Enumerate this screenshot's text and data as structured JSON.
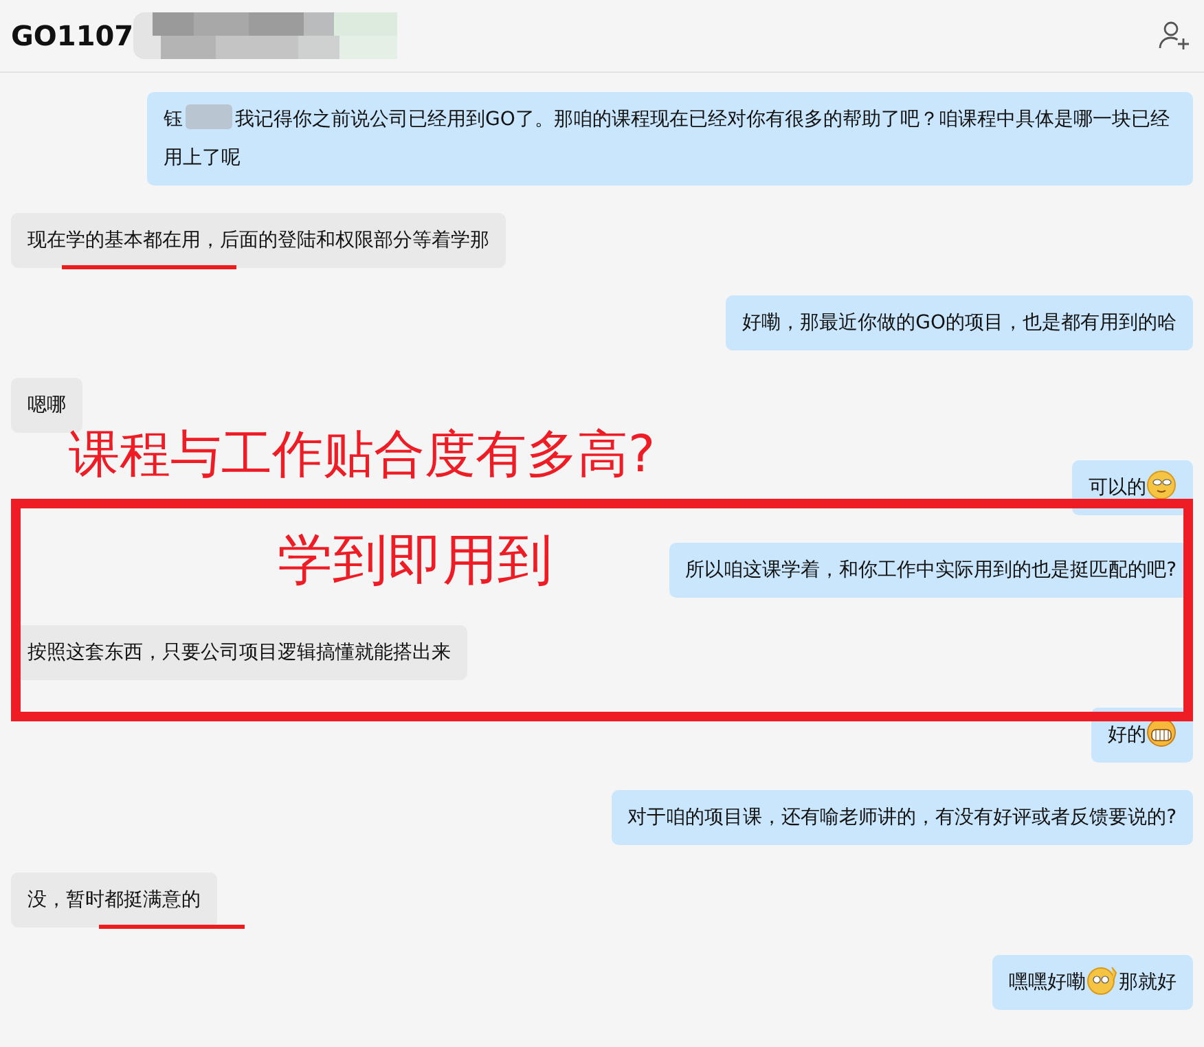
{
  "chat": {
    "title": "GO1107",
    "title_redacted": true
  },
  "messages": [
    {
      "outgoing": true,
      "parts": [
        {
          "kind": "text",
          "prefix": "钰",
          "redacted": true,
          "text": "我记得你之前说公司已经用到GO了。那咱的课程现在已经对你有很多的帮助了吧？咱课程中具体是哪一块已经用上了呢"
        }
      ]
    },
    {
      "outgoing": false,
      "parts": [
        {
          "kind": "text",
          "text": "现在学的基本都在用，后面的登陆和权限部分等着学那"
        }
      ]
    },
    {
      "outgoing": true,
      "parts": [
        {
          "kind": "text",
          "text": "好嘞，那最近你做的GO的项目，也是都有用到的哈"
        }
      ]
    },
    {
      "outgoing": false,
      "parts": [
        {
          "kind": "text",
          "text": "嗯哪"
        }
      ]
    },
    {
      "outgoing": true,
      "parts": [
        {
          "kind": "text",
          "text": "可以的"
        },
        {
          "kind": "emoji_smirk"
        }
      ]
    },
    {
      "outgoing": true,
      "parts": [
        {
          "kind": "text",
          "text": "所以咱这课学着，和你工作中实际用到的也是挺匹配的吧?"
        }
      ]
    },
    {
      "outgoing": false,
      "parts": [
        {
          "kind": "text",
          "text": "按照这套东西，只要公司项目逻辑搞懂就能搭出来"
        }
      ]
    },
    {
      "outgoing": true,
      "parts": [
        {
          "kind": "text",
          "text": "好的"
        },
        {
          "kind": "emoji_grin"
        }
      ]
    },
    {
      "outgoing": true,
      "parts": [
        {
          "kind": "text",
          "text": "对于咱的项目课，还有喻老师讲的，有没有好评或者反馈要说的?"
        }
      ]
    },
    {
      "outgoing": false,
      "parts": [
        {
          "kind": "text",
          "text": "没，暂时都挺满意的"
        }
      ]
    },
    {
      "outgoing": true,
      "parts": [
        {
          "kind": "text",
          "text": "嘿嘿好嘞"
        },
        {
          "kind": "emoji_wave"
        },
        {
          "kind": "text",
          "text": "那就好"
        }
      ]
    }
  ],
  "annotations": [
    {
      "kind": "underline"
    },
    {
      "kind": "headline",
      "text": "课程与工作贴合度有多高?"
    },
    {
      "kind": "frame"
    },
    {
      "kind": "callout",
      "text": "学到即用到"
    },
    {
      "kind": "underline"
    }
  ]
}
